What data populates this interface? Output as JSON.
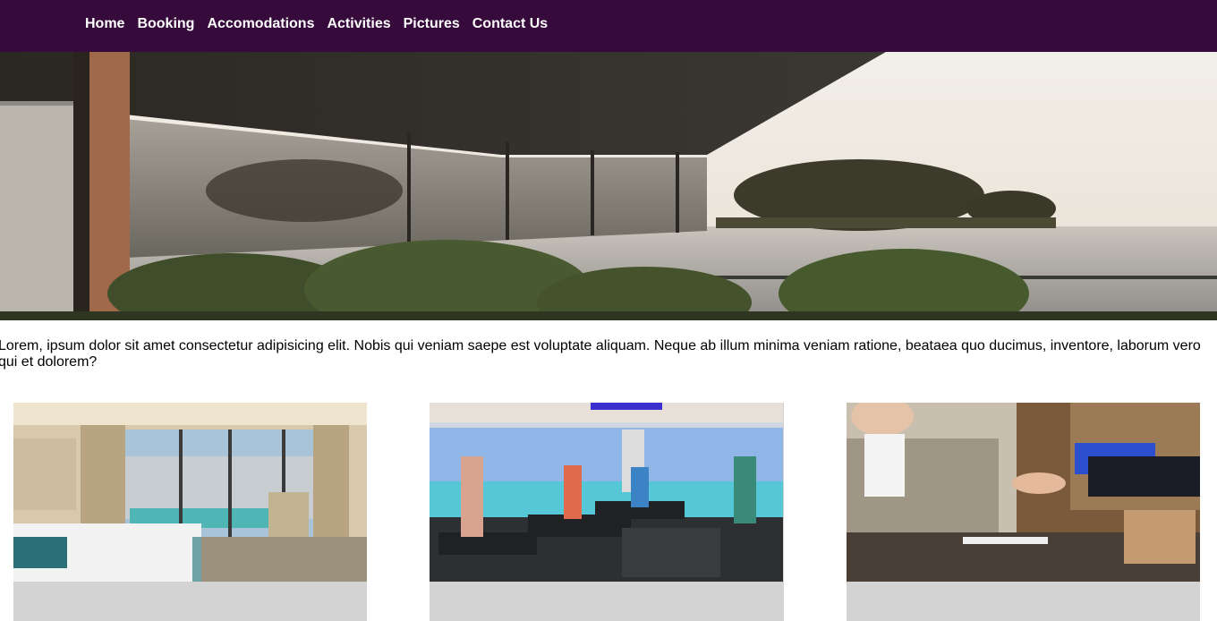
{
  "nav": {
    "items": [
      {
        "label": "Home"
      },
      {
        "label": "Booking"
      },
      {
        "label": "Accomodations"
      },
      {
        "label": "Activities"
      },
      {
        "label": "Pictures"
      },
      {
        "label": "Contact Us"
      }
    ]
  },
  "intro": {
    "text": "Lorem, ipsum dolor sit amet consectetur adipisicing elit. Nobis qui veniam saepe est voluptate aliquam. Neque ab illum minima veniam ratione, beataea quo ducimus, inventore, laborum vero qui et dolorem?"
  },
  "theme": {
    "nav_bg": "#360a3b",
    "nav_text": "#ffffff",
    "card_bg": "#d3d3d3"
  }
}
